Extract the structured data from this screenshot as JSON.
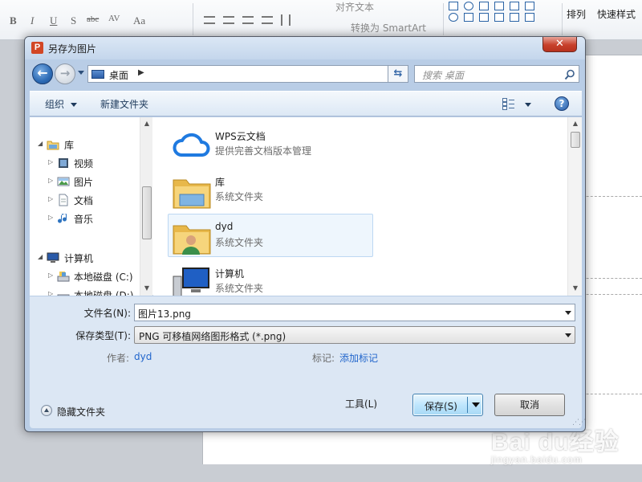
{
  "background": {
    "ribbon": {
      "font_buttons": [
        "B",
        "I",
        "U",
        "S",
        "abc",
        "AV",
        "Aa"
      ],
      "align_text": "对齐文本",
      "smartart": "转换为 SmartArt",
      "arrange": "排列",
      "quick_styles": "快速样式"
    },
    "watermark": {
      "logo": "Bai du经验",
      "url": "jingyan.baidu.com"
    }
  },
  "dialog": {
    "title": "另存为图片",
    "app_icon_letter": "P",
    "close_glyph": "✕",
    "address": {
      "location": "桌面",
      "chevron": "▶"
    },
    "search": {
      "placeholder": "搜索 桌面"
    },
    "toolbar": {
      "organize": "组织",
      "new_folder": "新建文件夹",
      "help": "?"
    },
    "nav_tree": [
      {
        "label": "库",
        "icon": "library-icon",
        "level": 0,
        "expander": "◢"
      },
      {
        "label": "视频",
        "icon": "video-icon",
        "level": 1,
        "expander": "▷"
      },
      {
        "label": "图片",
        "icon": "pictures-icon",
        "level": 1,
        "expander": "▷"
      },
      {
        "label": "文档",
        "icon": "documents-icon",
        "level": 1,
        "expander": "▷"
      },
      {
        "label": "音乐",
        "icon": "music-icon",
        "level": 1,
        "expander": "▷"
      },
      {
        "label": "计算机",
        "icon": "computer-icon",
        "level": 0,
        "expander": "◢"
      },
      {
        "label": "本地磁盘 (C:)",
        "icon": "drive-icon",
        "level": 1,
        "expander": "▷"
      },
      {
        "label": "本地磁盘 (D:)",
        "icon": "drive-icon",
        "level": 1,
        "expander": "▷"
      }
    ],
    "files": [
      {
        "name": "WPS云文档",
        "subtitle": "提供完善文档版本管理",
        "icon": "cloud-icon"
      },
      {
        "name": "库",
        "subtitle": "系统文件夹",
        "icon": "library-folder-icon"
      },
      {
        "name": "dyd",
        "subtitle": "系统文件夹",
        "icon": "user-folder-icon",
        "selected": true
      },
      {
        "name": "计算机",
        "subtitle": "系统文件夹",
        "icon": "computer-icon"
      }
    ],
    "form": {
      "filename_label": "文件名(N):",
      "filename_value": "图片13.png",
      "type_label": "保存类型(T):",
      "type_value": "PNG 可移植网络图形格式 (*.png)",
      "author_label": "作者:",
      "author_value": "dyd",
      "tags_label": "标记:",
      "tags_value": "添加标记"
    },
    "footer": {
      "hide_folders": "隐藏文件夹",
      "tools": "工具(L)",
      "save": "保存(S)",
      "cancel": "取消"
    }
  },
  "colors": {
    "dialog_frame": "#b9cde6",
    "link": "#2266cc",
    "selection": "#eef6fd",
    "close_red": "#c7402b"
  }
}
